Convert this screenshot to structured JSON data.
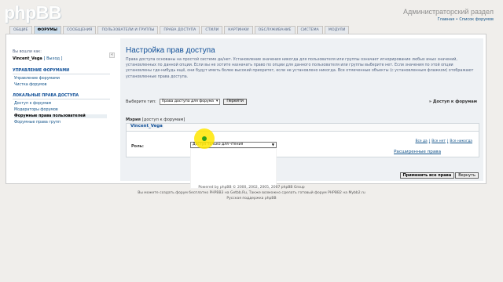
{
  "brand": {
    "logo_text": "phpBB"
  },
  "header": {
    "title": "Администраторский раздел",
    "links": "Главная • Список форумов"
  },
  "tabs": [
    {
      "label": "ОБЩИЕ"
    },
    {
      "label": "ФОРУМЫ",
      "active": true
    },
    {
      "label": "СООБЩЕНИЯ"
    },
    {
      "label": "ПОЛЬЗОВАТЕЛИ И ГРУППЫ"
    },
    {
      "label": "ПРАВА ДОСТУПА"
    },
    {
      "label": "СТИЛИ"
    },
    {
      "label": "КАРТИНКИ"
    },
    {
      "label": "ОБСЛУЖИВАНИЕ"
    },
    {
      "label": "СИСТЕМА"
    },
    {
      "label": "МОДУЛИ"
    }
  ],
  "sidebar": {
    "logged_in_as": "Вы вошли как:",
    "username": "Vincent_Vega",
    "logout": "[ Выход ]",
    "sections": [
      {
        "heading": "УПРАВЛЕНИЕ ФОРУМАМИ",
        "items": [
          "Управление форумами",
          "Чистка форумов"
        ]
      },
      {
        "heading": "ЛОКАЛЬНЫЕ ПРАВА ДОСТУПА",
        "items": [
          "Доступ к форумам",
          "Модераторы форумов",
          "Форумные права пользователей",
          "Форумные права групп"
        ]
      }
    ],
    "active_item": "Форумные права пользователей"
  },
  "main": {
    "title": "Настройка прав доступа",
    "description": "Права доступа основаны на простой системе да/нет. Установление значения никогда для пользователя или группы означает игнорирование любых иных значений, установленных по данной опции. Если вы не хотите назначать право по опции для данного пользователя или группы выберите нет. Если значения по этой опции установлены где-нибудь ещё, они будут иметь более высокий приоритет, если не установлено никогда. Все отмеченные объекты (с установленным флажком) отображают установленные права доступа.",
    "select_type_label": "Выберите тип:",
    "select_type_value": "Права доступа для форума",
    "go_button": "Перейти",
    "to_forum_permissions": "» Доступ к форумам",
    "forum_name": "Мэрия",
    "forum_sub": "[доступ к форумам]",
    "user_legend": "Vincent_Vega",
    "role_label": "Роль:",
    "role_value": "Доступ только для чтения",
    "quick_links": [
      "Все да",
      "Все нет",
      "Все никогда"
    ],
    "advanced_link": "Расширенные права",
    "apply_all": "Применить все права",
    "reset": "Вернуть"
  },
  "footer": {
    "line1": "Powered by phpBB © 2000, 2002, 2005, 2007 phpBB Group",
    "line2": "Вы можете создать форум бесплатно PHPBB3 на Getbb.Ru, Также возможно сделать готовый форум PHPBB2 на Mybb2.ru",
    "line3": "Русская поддержка phpBB"
  },
  "colors": {
    "accent": "#115098",
    "link": "#105289",
    "active_tab": "#cadceb",
    "cursor_highlight": "#ffe600"
  }
}
